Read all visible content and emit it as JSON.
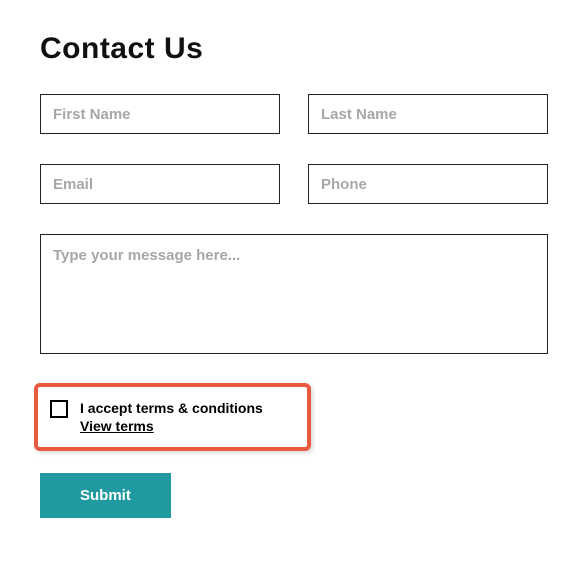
{
  "title": "Contact Us",
  "fields": {
    "first_name": {
      "placeholder": "First Name",
      "value": ""
    },
    "last_name": {
      "placeholder": "Last Name",
      "value": ""
    },
    "email": {
      "placeholder": "Email",
      "value": ""
    },
    "phone": {
      "placeholder": "Phone",
      "value": ""
    },
    "message": {
      "placeholder": "Type your message here...",
      "value": ""
    }
  },
  "terms": {
    "accepted": false,
    "label": "I accept terms & conditions",
    "link_text": "View terms"
  },
  "submit_label": "Submit",
  "colors": {
    "highlight_border": "#e8593f",
    "submit_bg": "#209aa0"
  }
}
